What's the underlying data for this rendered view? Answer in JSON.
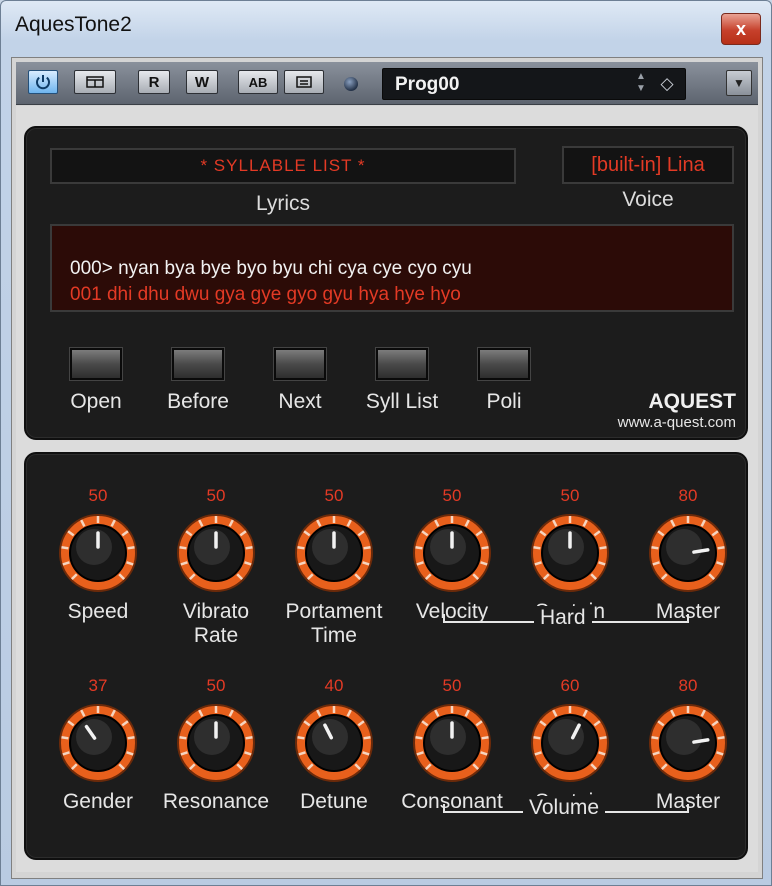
{
  "window": {
    "title": "AquesTone2",
    "close_glyph": "x"
  },
  "toolbar": {
    "power_icon": "power-icon",
    "buttons": [
      "R",
      "W"
    ],
    "compare_label": "AB",
    "preset": "Prog00",
    "spin_up": "▲",
    "spin_down": "▼",
    "load_glyph": "◇",
    "menu_glyph": "▼"
  },
  "lyrics_panel": {
    "syllable_list": "* SYLLABLE LIST *",
    "lyrics_label": "Lyrics",
    "voice_value": "[built-in] Lina",
    "voice_label": "Voice",
    "line_current": "000> nyan bya bye byo byu chi cya cye cyo cyu",
    "line_next": "001  dhi dhu dwu gya gye gyo gyu hya hye hyo",
    "buttons": [
      {
        "label": "Open"
      },
      {
        "label": "Before"
      },
      {
        "label": "Next"
      },
      {
        "label": "Syll List"
      },
      {
        "label": "Poli"
      }
    ],
    "brand": "AQUEST",
    "brand_url": "www.a-quest.com"
  },
  "knobs_row1": [
    {
      "name": "Speed",
      "name2": "",
      "value": 50
    },
    {
      "name": "Vibrato",
      "name2": "Rate",
      "value": 50
    },
    {
      "name": "Portament",
      "name2": "Time",
      "value": 50
    },
    {
      "name": "Velocity",
      "name2": "",
      "value": 50
    },
    {
      "name": "Sustain",
      "name2": "",
      "value": 50
    },
    {
      "name": "Master",
      "name2": "",
      "value": 80
    }
  ],
  "knobs_row2": [
    {
      "name": "Gender",
      "name2": "",
      "value": 37
    },
    {
      "name": "Resonance",
      "name2": "",
      "value": 50
    },
    {
      "name": "Detune",
      "name2": "",
      "value": 40
    },
    {
      "name": "Consonant",
      "name2": "",
      "value": 50
    },
    {
      "name": "Sustain",
      "name2": "",
      "value": 60
    },
    {
      "name": "Master",
      "name2": "",
      "value": 80
    }
  ],
  "groups": {
    "hard": "Hard",
    "volume": "Volume"
  },
  "colors": {
    "accent_red": "#e33a25",
    "knob_ring": "#e8601c",
    "panel": "#1c1c1c"
  }
}
